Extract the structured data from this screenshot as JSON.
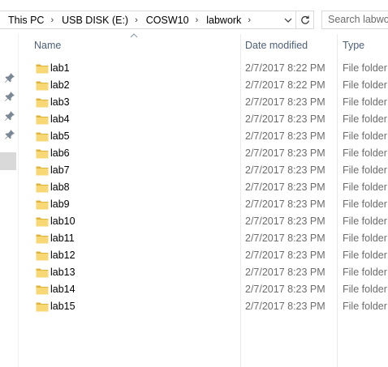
{
  "address": {
    "breadcrumbs": [
      "This PC",
      "USB DISK (E:)",
      "COSW10",
      "labwork"
    ],
    "dropdown_icon": "chevron-down-icon",
    "refresh_icon": "refresh-icon"
  },
  "search": {
    "placeholder": "Search labwork"
  },
  "columns": {
    "name": "Name",
    "date": "Date modified",
    "type": "Type"
  },
  "rows": [
    {
      "name": "lab1",
      "date": "2/7/2017 8:22 PM",
      "type": "File folder"
    },
    {
      "name": "lab2",
      "date": "2/7/2017 8:22 PM",
      "type": "File folder"
    },
    {
      "name": "lab3",
      "date": "2/7/2017 8:23 PM",
      "type": "File folder"
    },
    {
      "name": "lab4",
      "date": "2/7/2017 8:23 PM",
      "type": "File folder"
    },
    {
      "name": "lab5",
      "date": "2/7/2017 8:23 PM",
      "type": "File folder"
    },
    {
      "name": "lab6",
      "date": "2/7/2017 8:23 PM",
      "type": "File folder"
    },
    {
      "name": "lab7",
      "date": "2/7/2017 8:23 PM",
      "type": "File folder"
    },
    {
      "name": "lab8",
      "date": "2/7/2017 8:23 PM",
      "type": "File folder"
    },
    {
      "name": "lab9",
      "date": "2/7/2017 8:23 PM",
      "type": "File folder"
    },
    {
      "name": "lab10",
      "date": "2/7/2017 8:23 PM",
      "type": "File folder"
    },
    {
      "name": "lab11",
      "date": "2/7/2017 8:23 PM",
      "type": "File folder"
    },
    {
      "name": "lab12",
      "date": "2/7/2017 8:23 PM",
      "type": "File folder"
    },
    {
      "name": "lab13",
      "date": "2/7/2017 8:23 PM",
      "type": "File folder"
    },
    {
      "name": "lab14",
      "date": "2/7/2017 8:23 PM",
      "type": "File folder"
    },
    {
      "name": "lab15",
      "date": "2/7/2017 8:23 PM",
      "type": "File folder"
    }
  ],
  "colors": {
    "folder": "#f8d775",
    "folder_dark": "#e0b43c",
    "header_text": "#4c607a",
    "meta_text": "#6d6d6d"
  }
}
